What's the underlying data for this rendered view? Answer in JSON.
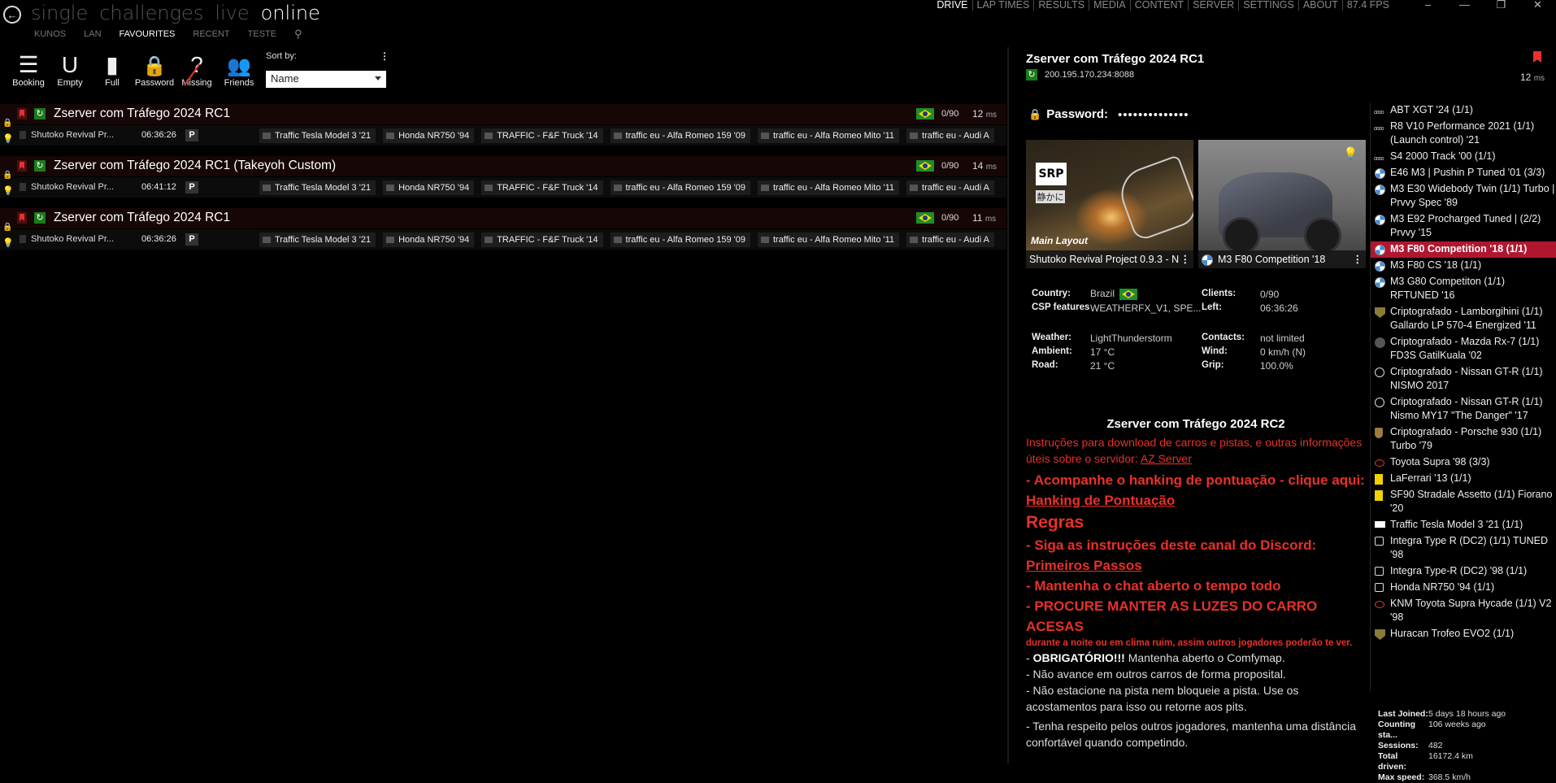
{
  "nav": {
    "modes": [
      "single",
      "challenges",
      "live",
      "online"
    ],
    "active_mode": "online",
    "tabs": [
      "KUNOS",
      "LAN",
      "FAVOURITES",
      "RECENT",
      "TESTE"
    ],
    "active_tab": "FAVOURITES",
    "top_links": [
      "DRIVE",
      "LAP TIMES",
      "RESULTS",
      "MEDIA",
      "CONTENT",
      "SERVER",
      "SETTINGS",
      "ABOUT",
      "87.4 FPS"
    ],
    "active_top": "DRIVE",
    "window_controls": [
      "–",
      "—",
      "❐",
      "✕"
    ]
  },
  "filters": [
    {
      "label": "Booking",
      "icon": "checklist-icon",
      "glyph": "☰"
    },
    {
      "label": "Empty",
      "icon": "empty-slot-icon",
      "glyph": "U"
    },
    {
      "label": "Full",
      "icon": "full-slot-icon",
      "glyph": "▮"
    },
    {
      "label": "Password",
      "icon": "lock-icon",
      "glyph": "🔒"
    },
    {
      "label": "Missing",
      "icon": "missing-icon",
      "glyph": "?"
    },
    {
      "label": "Friends",
      "icon": "friends-icon",
      "glyph": "👥"
    }
  ],
  "sort": {
    "label": "Sort by:",
    "value": "Name",
    "menu": "⋮"
  },
  "servers": [
    {
      "name": "Zserver com Tráfego 2024 RC1",
      "clients": "0/90",
      "ping": "12",
      "ping_unit": "ms",
      "track": "Shutoko Revival Pr...",
      "time": "06:36:26",
      "p": "P",
      "cars": [
        "Traffic Tesla Model 3 '21",
        "Honda NR750 '94",
        "TRAFFIC - F&F Truck '14",
        "traffic eu - Alfa Romeo 159 '09",
        "traffic eu - Alfa Romeo Mito '11",
        "traffic eu - Audi A"
      ]
    },
    {
      "name": "Zserver com Tráfego 2024 RC1 (Takeyoh Custom)",
      "clients": "0/90",
      "ping": "14",
      "ping_unit": "ms",
      "track": "Shutoko Revival Pr...",
      "time": "06:41:12",
      "p": "P",
      "cars": [
        "Traffic Tesla Model 3 '21",
        "Honda NR750 '94",
        "TRAFFIC - F&F Truck '14",
        "traffic eu - Alfa Romeo 159 '09",
        "traffic eu - Alfa Romeo Mito '11",
        "traffic eu - Audi A"
      ]
    },
    {
      "name": "Zserver com Tráfego 2024 RC1",
      "clients": "0/90",
      "ping": "11",
      "ping_unit": "ms",
      "track": "Shutoko Revival Pr...",
      "time": "06:36:26",
      "p": "P",
      "cars": [
        "Traffic Tesla Model 3 '21",
        "Honda NR750 '94",
        "TRAFFIC - F&F Truck '14",
        "traffic eu - Alfa Romeo 159 '09",
        "traffic eu - Alfa Romeo Mito '11",
        "traffic eu - Audi A"
      ]
    }
  ],
  "detail": {
    "title": "Zserver com Tráfego 2024 RC1",
    "address": "200.195.170.234:8088",
    "ping": "12",
    "ping_unit": "ms",
    "password_label": "Password:",
    "password_value": "••••••••••••••",
    "track_logo": "SRP",
    "track_sign": "静かに",
    "track_layout": "Main Layout",
    "track_caption": "Shutoko Revival Project 0.9.3 - N",
    "car_caption": "M3 F80 Competition '18",
    "info": {
      "country_label": "Country:",
      "country": "Brazil",
      "csp_label": "CSP features",
      "csp": "WEATHERFX_V1, SPE...",
      "clients_label": "Clients:",
      "clients": "0/90",
      "left_label": "Left:",
      "left": "06:36:26",
      "weather_label": "Weather:",
      "weather": "LightThunderstorm",
      "ambient_label": "Ambient:",
      "ambient": "17 °C",
      "road_label": "Road:",
      "road": "21 °C",
      "contacts_label": "Contacts:",
      "contacts": "not limited",
      "wind_label": "Wind:",
      "wind": "0 km/h (N)",
      "grip_label": "Grip:",
      "grip": "100.0%"
    },
    "description": {
      "heading": "Zserver com Tráfego 2024 RC2",
      "intro": "Instruções para download de carros e pistas, e outras informações úteis sobre o servidor: ",
      "intro_link": " AZ Server",
      "ranking": "- Acompanhe o hanking de pontuação - clique aqui: ",
      "ranking_link": " Hanking de Pontuação",
      "rules": "Regras",
      "rule1": "- Siga as instruções deste canal do Discord: ",
      "rule1_link": "Primeiros Passos",
      "rule2": "- Mantenha o chat aberto o tempo todo",
      "rule3": "- PROCURE MANTER AS LUZES DO CARRO ACESAS",
      "rule3_note": "durante a noite ou em clima ruim, assim outros jogadores poderão te ver.",
      "mandatory_prefix": "- ",
      "mandatory_bold": "OBRIGATÓRIO!!!",
      "mandatory_text": " Mantenha aberto o Comfymap.",
      "line1": "- Não avance em outros carros de forma proposital.",
      "line2": "- Não estacione na pista nem bloqueie a pista. Use os acostamentos para isso ou retorne aos pits.",
      "line3": "- Tenha respeito pelos outros jogadores, mantenha uma distância confortável quando competindo."
    }
  },
  "car_list": [
    {
      "label": "ABT XGT '24 (1/1)",
      "brand": "audi"
    },
    {
      "label": "R8 V10 Performance 2021 (1/1) (Launch control) '21",
      "brand": "audi"
    },
    {
      "label": "S4 2000 Track '00 (1/1)",
      "brand": "audi"
    },
    {
      "label": "E46 M3 | Pushin P Tuned '01 (3/3)",
      "brand": "bmw"
    },
    {
      "label": "M3 E30 Widebody Twin (1/1) Turbo | Prvvy Spec '89",
      "brand": "bmw"
    },
    {
      "label": "M3 E92 Procharged Tuned | (2/2) Prvvy '15",
      "brand": "bmw"
    },
    {
      "label": "M3 F80 Competition '18 (1/1)",
      "brand": "bmw",
      "selected": true
    },
    {
      "label": "M3 F80 CS '18 (1/1)",
      "brand": "bmw"
    },
    {
      "label": "M3 G80 Competiton (1/1) RFTUNED '16",
      "brand": "bmw"
    },
    {
      "label": "Criptografado - Lamborgihini (1/1) Gallardo LP 570-4 Energized '11",
      "brand": "lambo"
    },
    {
      "label": "Criptografado - Mazda Rx-7 (1/1) FD3S GatilKuala '02",
      "brand": "gen"
    },
    {
      "label": "Criptografado - Nissan GT-R (1/1) NISMO 2017",
      "brand": "nissan"
    },
    {
      "label": "Criptografado - Nissan GT-R (1/1) Nismo MY17 \"The Danger\" '17",
      "brand": "nissan"
    },
    {
      "label": "Criptografado - Porsche 930 (1/1) Turbo '79",
      "brand": "porsche"
    },
    {
      "label": "Toyota Supra '98 (3/3)",
      "brand": "toyota"
    },
    {
      "label": "LaFerrari '13 (1/1)",
      "brand": "ferrari"
    },
    {
      "label": "SF90 Stradale Assetto (1/1) Fiorano '20",
      "brand": "ferrari"
    },
    {
      "label": "Traffic Tesla Model 3 '21 (1/1)",
      "brand": "tesla"
    },
    {
      "label": "Integra Type R (DC2) (1/1) TUNED '98",
      "brand": "honda"
    },
    {
      "label": "Integra Type-R (DC2) '98 (1/1)",
      "brand": "honda"
    },
    {
      "label": "Honda NR750 '94 (1/1)",
      "brand": "honda"
    },
    {
      "label": "KNM Toyota Supra Hycade (1/1) V2 '98",
      "brand": "toyota"
    },
    {
      "label": "Huracan Trofeo EVO2 (1/1)",
      "brand": "lambo"
    }
  ],
  "stats": [
    {
      "label": "Last Joined:",
      "value": "5 days 18 hours ago"
    },
    {
      "label": "Counting sta...",
      "value": "106 weeks ago"
    },
    {
      "label": "Sessions:",
      "value": "482"
    },
    {
      "label": "Total driven:",
      "value": "16172.4 km"
    },
    {
      "label": "Max speed:",
      "value": "368.5 km/h"
    }
  ],
  "colors": {
    "accent_red": "#e8302a",
    "selected_bg": "#b0172f",
    "refresh_green": "#1b7a1b"
  }
}
